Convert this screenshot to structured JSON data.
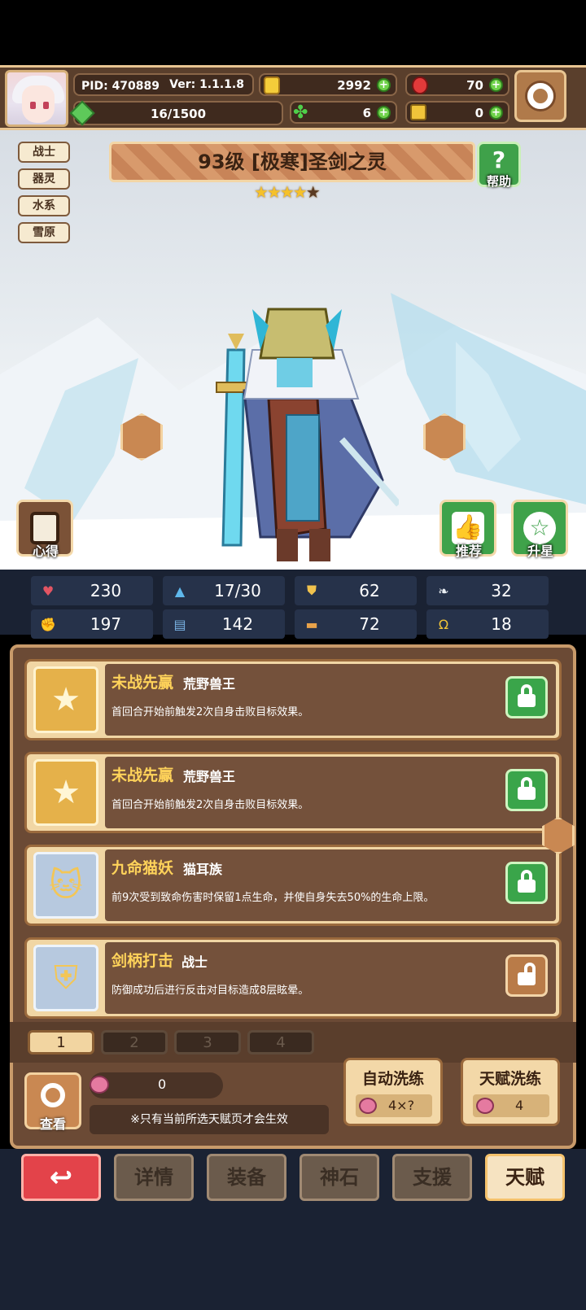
{
  "header": {
    "pid": "PID: 470889",
    "version": "Ver: 1.1.1.8",
    "gold": "2992",
    "ruby": "70",
    "energy": "16/1500",
    "clover": "6",
    "key": "0"
  },
  "hero": {
    "tags": [
      "战士",
      "器灵",
      "水系",
      "雪原"
    ],
    "title": "93级 [极寒]圣剑之灵",
    "stars": 4,
    "help_label": "帮助"
  },
  "side_buttons": {
    "insight": "心得",
    "recommend": "推荐",
    "star_up": "升星"
  },
  "stats": [
    {
      "icon": "heart-icon",
      "value": "230",
      "color": "#e25563"
    },
    {
      "icon": "droplet-icon",
      "value": "17/30",
      "color": "#5fb8ec"
    },
    {
      "icon": "shield-icon",
      "value": "62",
      "color": "#f0c24d"
    },
    {
      "icon": "wing-icon",
      "value": "32",
      "color": "#e9eef3"
    },
    {
      "icon": "fist-icon",
      "value": "197",
      "color": "#e47d7d"
    },
    {
      "icon": "book-icon",
      "value": "142",
      "color": "#7bb5e6"
    },
    {
      "icon": "scroll-icon",
      "value": "72",
      "color": "#e8a24a"
    },
    {
      "icon": "horseshoe-icon",
      "value": "18",
      "color": "#f1c438"
    }
  ],
  "talents": [
    {
      "name": "未战先赢",
      "sub": "荒野兽王",
      "desc": "首回合开始前触发2次自身击败目标效果。",
      "locked": true
    },
    {
      "name": "未战先赢",
      "sub": "荒野兽王",
      "desc": "首回合开始前触发2次自身击败目标效果。",
      "locked": true
    },
    {
      "name": "九命猫妖",
      "sub": "猫耳族",
      "desc": "前9次受到致命伤害时保留1点生命，并使自身失去50%的生命上限。",
      "locked": true
    },
    {
      "name": "剑柄打击",
      "sub": "战士",
      "desc": "防御成功后进行反击对目标造成8层眩晕。",
      "locked": false
    }
  ],
  "pages": [
    "1",
    "2",
    "3",
    "4"
  ],
  "footer": {
    "view_label": "查看",
    "gem_count": "0",
    "notice": "※只有当前所选天赋页才会生效",
    "auto_refine": "自动洗练",
    "auto_refine_cost": "4×?",
    "talent_refine": "天赋洗练",
    "talent_refine_cost": "4"
  },
  "nav": [
    "详情",
    "装备",
    "神石",
    "支援",
    "天赋"
  ]
}
